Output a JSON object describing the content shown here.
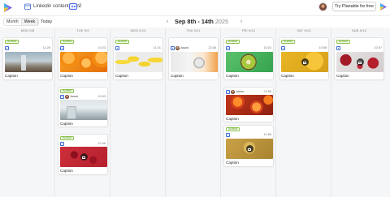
{
  "header": {
    "plan_title": "Linkedin content plan",
    "member_count": "2",
    "try_button": "Try Planable for free"
  },
  "toolbar": {
    "view_month": "Month",
    "view_week": "Week",
    "today": "Today",
    "prev": "‹",
    "next": "›",
    "range": "Sep 8th - 14th",
    "year": "2025"
  },
  "colors": {
    "accent": "#3f6bd6",
    "approved_green": "#8bc34a",
    "grid_bg": "#f5f6f7"
  },
  "days": [
    {
      "label": "MON 9/8",
      "posts": [
        {
          "badge": "Author",
          "author": "",
          "time": "11:28",
          "image": "interior-photo",
          "caption": "Caption"
        }
      ]
    },
    {
      "label": "TUE 9/9",
      "posts": [
        {
          "badge": "Author",
          "author": "",
          "time": "10:23",
          "image": "sliced-oranges",
          "caption": "Caption"
        },
        {
          "badge": "Author",
          "author": "Juuzo",
          "time": "10:03",
          "image": "kitchen-photo",
          "caption": "Caption"
        },
        {
          "badge": "Author",
          "author": "",
          "time": "10:46",
          "image": "raspberry-video",
          "caption": "Caption",
          "video": true
        }
      ]
    },
    {
      "label": "WED 9/10",
      "posts": [
        {
          "badge": "Author",
          "author": "",
          "time": "11:31",
          "image": "lemons",
          "caption": "Caption"
        }
      ]
    },
    {
      "label": "THU 9/11",
      "posts": [
        {
          "badge": "",
          "author": "Juuzo",
          "time": "22:08",
          "image": "juicer-photo",
          "caption": "Caption"
        }
      ]
    },
    {
      "label": "FRI 9/12",
      "posts": [
        {
          "badge": "Author",
          "author": "",
          "time": "10:24",
          "image": "kiwi",
          "caption": "Caption"
        },
        {
          "badge": "",
          "author": "Juuzo",
          "time": "23:58",
          "image": "citrus-slices",
          "caption": "Caption"
        },
        {
          "badge": "Author",
          "author": "",
          "time": "10:58",
          "image": "gold-video",
          "caption": "Caption",
          "video": true
        }
      ]
    },
    {
      "label": "SAT 9/13",
      "posts": [
        {
          "badge": "Author",
          "author": "",
          "time": "10:58",
          "image": "yellow-video",
          "caption": "Caption",
          "video": true
        }
      ]
    },
    {
      "label": "SUN 9/14",
      "posts": [
        {
          "badge": "Author",
          "author": "",
          "time": "10:57",
          "image": "pomegranate-video",
          "caption": "Caption",
          "video": true
        }
      ]
    }
  ]
}
